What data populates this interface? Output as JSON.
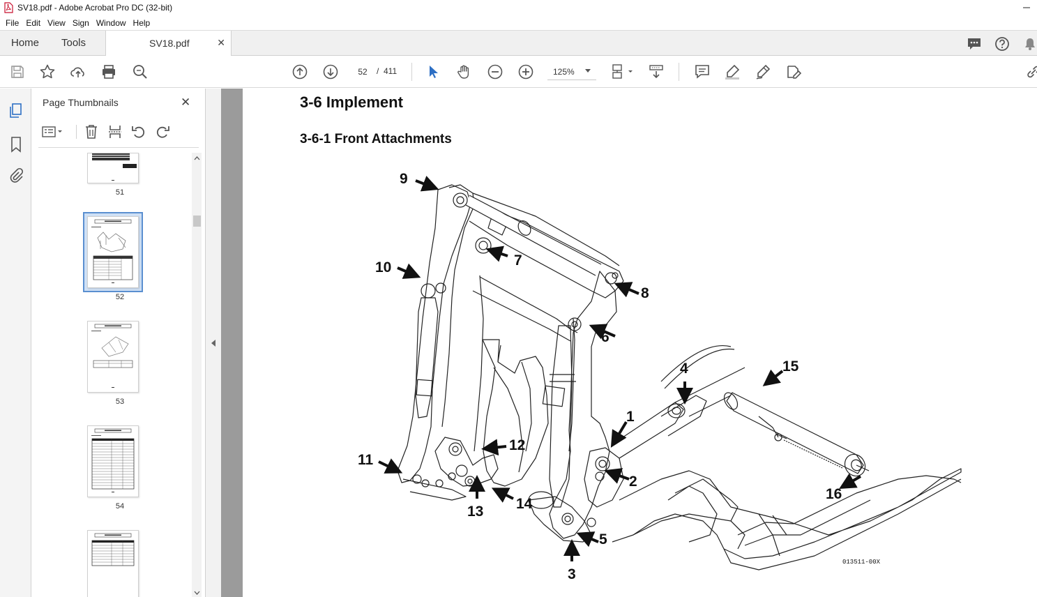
{
  "window": {
    "title": "SV18.pdf - Adobe Acrobat Pro DC (32-bit)"
  },
  "menu": [
    "File",
    "Edit",
    "View",
    "Sign",
    "Window",
    "Help"
  ],
  "tabs": {
    "home": "Home",
    "tools": "Tools",
    "document": "SV18.pdf",
    "close": "✕"
  },
  "toolbar": {
    "current_page": "52",
    "page_separator": "/",
    "total_pages": "411",
    "zoom": "125%"
  },
  "panel": {
    "title": "Page Thumbnails",
    "close": "✕",
    "thumbnails": [
      {
        "number": "51",
        "selected": false
      },
      {
        "number": "52",
        "selected": true
      },
      {
        "number": "53",
        "selected": false
      },
      {
        "number": "54",
        "selected": false
      },
      {
        "number": "",
        "selected": false
      }
    ]
  },
  "document": {
    "heading": "3-6  Implement",
    "subheading": "3-6-1  Front Attachments",
    "figure_code": "013511-00X",
    "callouts": [
      "1",
      "2",
      "3",
      "4",
      "5",
      "6",
      "7",
      "8",
      "9",
      "10",
      "11",
      "12",
      "13",
      "14",
      "15",
      "16"
    ]
  },
  "colors": {
    "accent_blue": "#2d6fc4",
    "select_blue": "#5a8fd0",
    "doc_background": "#9b9b9b"
  }
}
